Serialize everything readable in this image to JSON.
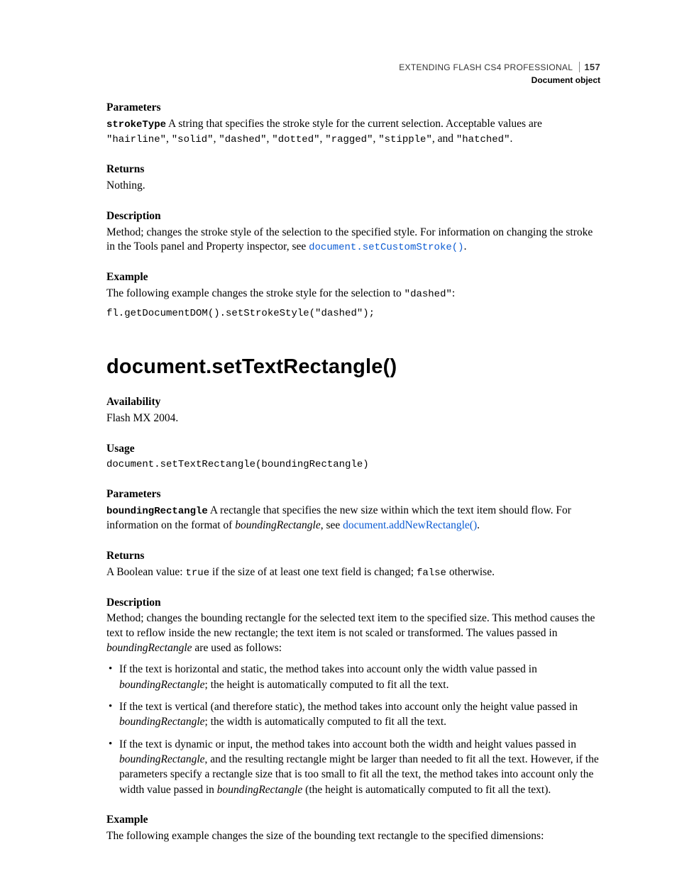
{
  "header": {
    "doc_title": "EXTENDING FLASH CS4 PROFESSIONAL",
    "page_number": "157",
    "section": "Document object"
  },
  "s1": {
    "parameters_label": "Parameters",
    "param_name": "strokeType",
    "param_text_a": "  A string that specifies the stroke style for the current selection. Acceptable values are ",
    "val_hairline": "\"hairline\"",
    "comma": ", ",
    "val_solid": "\"solid\"",
    "val_dashed": "\"dashed\"",
    "val_dotted": "\"dotted\"",
    "val_ragged": "\"ragged\"",
    "val_stipple": "\"stipple\"",
    "and": ", and ",
    "val_hatched": "\"hatched\"",
    "period": ".",
    "returns_label": "Returns",
    "returns_text": "Nothing.",
    "description_label": "Description",
    "description_text_a": "Method; changes the stroke style of the selection to the specified style. For information on changing the stroke in the Tools panel and Property inspector, see ",
    "description_link": "document.setCustomStroke()",
    "example_label": "Example",
    "example_text_a": "The following example changes the stroke style for the selection to ",
    "example_val": "\"dashed\"",
    "example_colon": ":",
    "code": "fl.getDocumentDOM().setStrokeStyle(\"dashed\");"
  },
  "s2": {
    "title": "document.setTextRectangle()",
    "availability_label": "Availability",
    "availability_text": "Flash MX 2004.",
    "usage_label": "Usage",
    "usage_code": "document.setTextRectangle(boundingRectangle)",
    "parameters_label": "Parameters",
    "param_name": "boundingRectangle",
    "param_text_a": "  A rectangle that specifies the new size within which the text item should flow. For information on the format of ",
    "param_em": "boundingRectangle",
    "param_text_b": ", see ",
    "param_link": "document.addNewRectangle()",
    "period": ".",
    "returns_label": "Returns",
    "returns_text_a": "A Boolean value: ",
    "returns_true": "true",
    "returns_text_b": " if the size of at least one text field is changed; ",
    "returns_false": "false",
    "returns_text_c": " otherwise.",
    "description_label": "Description",
    "description_text_a": "Method; changes the bounding rectangle for the selected text item to the specified size. This method causes the text to reflow inside the new rectangle; the text item is not scaled or transformed. The values passed in ",
    "description_em": "boundingRectangle",
    "description_text_b": " are used as follows:",
    "b1_a": "If the text is horizontal and static, the method takes into account only the width value passed in ",
    "b1_em": "boundingRectangle",
    "b1_b": "; the height is automatically computed to fit all the text.",
    "b2_a": "If the text is vertical (and therefore static), the method takes into account only the height value passed in ",
    "b2_em": "boundingRectangle",
    "b2_b": "; the width is automatically computed to fit all the text.",
    "b3_a": "If the text is dynamic or input, the method takes into account both the width and height values passed in ",
    "b3_em1": "boundingRectangle",
    "b3_b": ", and the resulting rectangle might be larger than needed to fit all the text. However, if the parameters specify a rectangle size that is too small to fit all the text, the method takes into account only the width value passed in ",
    "b3_em2": "boundingRectangle",
    "b3_c": " (the height is automatically computed to fit all the text).",
    "example_label": "Example",
    "example_text": "The following example changes the size of the bounding text rectangle to the specified dimensions:"
  }
}
